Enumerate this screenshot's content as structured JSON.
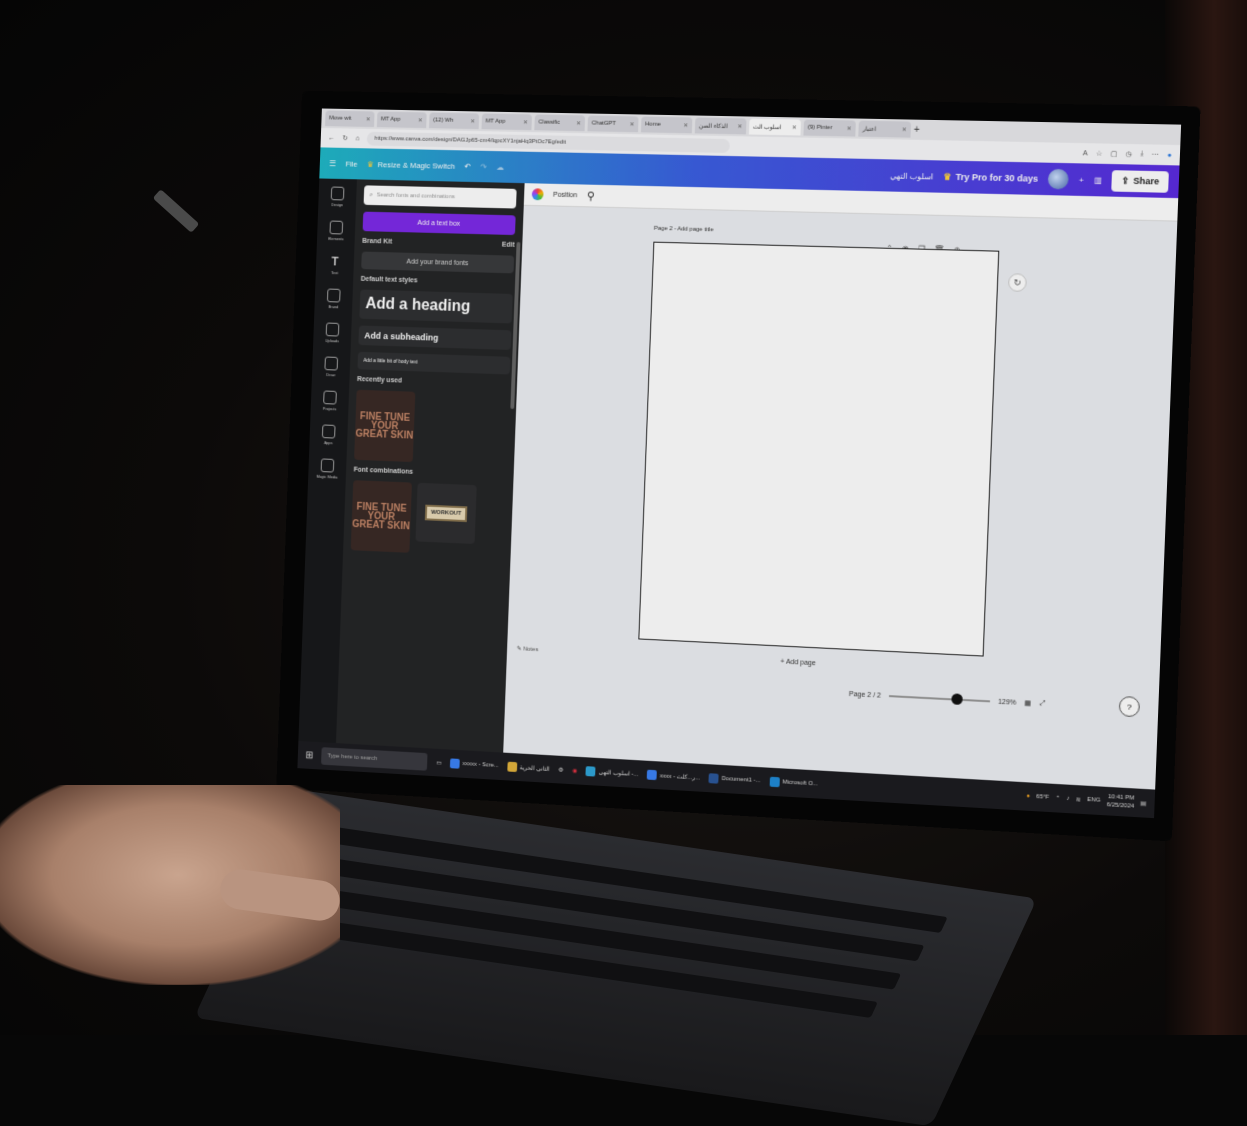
{
  "browser": {
    "tabs": [
      {
        "label": "Move wit",
        "active": false
      },
      {
        "label": "MT App",
        "active": false
      },
      {
        "label": "(12) Wh",
        "active": false
      },
      {
        "label": "MT App",
        "active": false
      },
      {
        "label": "Classific",
        "active": false
      },
      {
        "label": "ChatGPT",
        "active": false
      },
      {
        "label": "Home",
        "active": false
      },
      {
        "label": "الذكاء الصن",
        "active": false
      },
      {
        "label": "اسلوب الت",
        "active": true
      },
      {
        "label": "(9) Pinter",
        "active": false
      },
      {
        "label": "اعتبار",
        "active": false
      }
    ],
    "url": "https://www.canva.com/design/DAGJp65-cm4/lqpcXY1njaHq3PtOc7Eg/edit"
  },
  "canva": {
    "file_label": "File",
    "resize_label": "Resize & Magic Switch",
    "doc_title": "اسلوب التهي",
    "try_pro": "Try Pro for 30 days",
    "share": "Share",
    "brand_color_start": "#1fb8c7",
    "brand_color_end": "#5b2be0"
  },
  "rail": [
    {
      "label": "Design"
    },
    {
      "label": "Elements"
    },
    {
      "label": "Text"
    },
    {
      "label": "Brand"
    },
    {
      "label": "Uploads"
    },
    {
      "label": "Draw"
    },
    {
      "label": "Projects"
    },
    {
      "label": "Apps"
    },
    {
      "label": "Magic Media"
    }
  ],
  "panel": {
    "search_placeholder": "Search fonts and combinations",
    "add_text_box": "Add a text box",
    "brand_kit": "Brand Kit",
    "edit": "Edit",
    "add_brand_fonts": "Add your brand fonts",
    "default_text_styles": "Default text styles",
    "add_heading": "Add a heading",
    "add_subheading": "Add a subheading",
    "add_body": "Add a little bit of body text",
    "recently_used": "Recently used",
    "font_combinations": "Font combinations",
    "thumb_text": "FINE TUNE YOUR GREAT SKIN",
    "badge_text": "WORKOUT"
  },
  "editor": {
    "position": "Position",
    "page_title": "Page 2 - Add page title",
    "add_page": "+ Add page",
    "notes": "Notes",
    "page_count": "Page 2 / 2",
    "zoom": "129%",
    "zoom_fraction": 0.62
  },
  "taskbar": {
    "search_placeholder": "Type here to search",
    "apps": [
      {
        "label": "xxxxx - Scre..."
      },
      {
        "label": "الثاني الحرية"
      },
      {
        "label": "اسلوب التهي -..."
      },
      {
        "label": "xxxx - ر...كلت..."
      },
      {
        "label": "Document1 -..."
      },
      {
        "label": "Microsoft O..."
      }
    ],
    "weather": "65°F",
    "lang": "ENG",
    "time": "10:41 PM",
    "date": "6/25/2024"
  }
}
